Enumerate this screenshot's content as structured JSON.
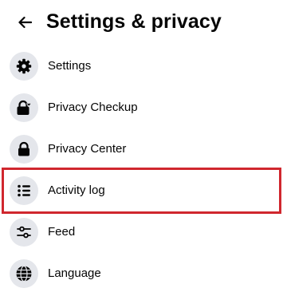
{
  "header": {
    "title": "Settings & privacy",
    "back_icon": "arrow-left-icon"
  },
  "menu": {
    "items": [
      {
        "label": "Settings",
        "icon": "gear-icon"
      },
      {
        "label": "Privacy Checkup",
        "icon": "lock-heart-icon"
      },
      {
        "label": "Privacy Center",
        "icon": "lock-icon"
      },
      {
        "label": "Activity log",
        "icon": "list-icon",
        "highlighted": true
      },
      {
        "label": "Feed",
        "icon": "sliders-icon"
      },
      {
        "label": "Language",
        "icon": "globe-icon"
      }
    ]
  },
  "colors": {
    "text": "#050505",
    "icon_background": "#e4e6eb",
    "highlight_border": "#d0272e"
  }
}
